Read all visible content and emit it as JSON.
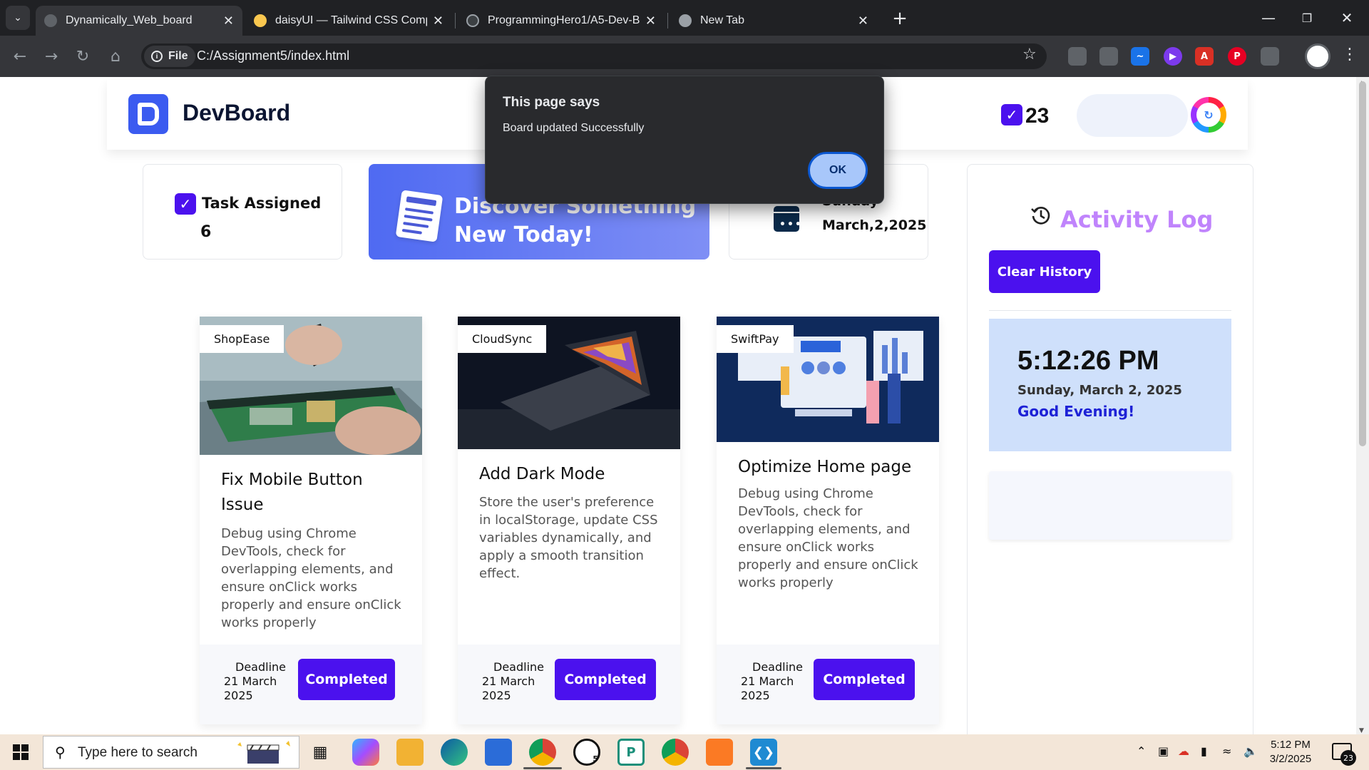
{
  "browser": {
    "tabs": [
      {
        "label": "Dynamically_Web_board",
        "active": true
      },
      {
        "label": "daisyUI — Tailwind CSS Compo",
        "active": false
      },
      {
        "label": "ProgrammingHero1/A5-Dev-Bo",
        "active": false
      },
      {
        "label": "New Tab",
        "active": false
      }
    ],
    "file_chip": "File",
    "url": "C:/Assignment5/index.html"
  },
  "header": {
    "brand_bold": "DevBoard",
    "task_count": "23"
  },
  "stats": {
    "task_assigned_label": "Task Assigned",
    "task_assigned_value": "6",
    "discover_text": "Discover Something New Today!",
    "date_day": "Sunday",
    "date_value": "March,2,2025"
  },
  "tasks": [
    {
      "tag": "ShopEase",
      "title": "Fix Mobile Button Issue",
      "description": "Debug using Chrome DevTools, check for overlapping elements, and ensure onClick works properly and ensure onClick works properly",
      "deadline_label": "Deadline",
      "deadline": "21 March 2025",
      "button": "Completed"
    },
    {
      "tag": "CloudSync",
      "title": "Add Dark Mode",
      "description": "Store the user's preference in localStorage, update CSS variables dynamically, and apply a smooth transition effect.",
      "deadline_label": "Deadline",
      "deadline": "21 March 2025",
      "button": "Completed"
    },
    {
      "tag": "SwiftPay",
      "title": "Optimize Home page",
      "description": "Debug using Chrome DevTools, check for overlapping elements, and ensure onClick works properly and ensure onClick works properly",
      "deadline_label": "Deadline",
      "deadline": "21 March 2025",
      "button": "Completed"
    }
  ],
  "activity": {
    "title": "Activity Log",
    "clear_button": "Clear History",
    "time": "5:12:26 PM",
    "date": "Sunday, March 2, 2025",
    "greeting": "Good Evening!"
  },
  "dialog": {
    "title": "This page says",
    "message": "Board updated Successfully",
    "ok": "OK"
  },
  "taskbar": {
    "search_placeholder": "Type here to search",
    "time": "5:12 PM",
    "date": "3/2/2025",
    "notification_count": "23",
    "whatsapp_badge": "5"
  },
  "colors": {
    "primary": "#4b11ee",
    "activity_title": "#c084fc",
    "clock_bg": "#cfe0fb",
    "greeting": "#1e22d6"
  }
}
